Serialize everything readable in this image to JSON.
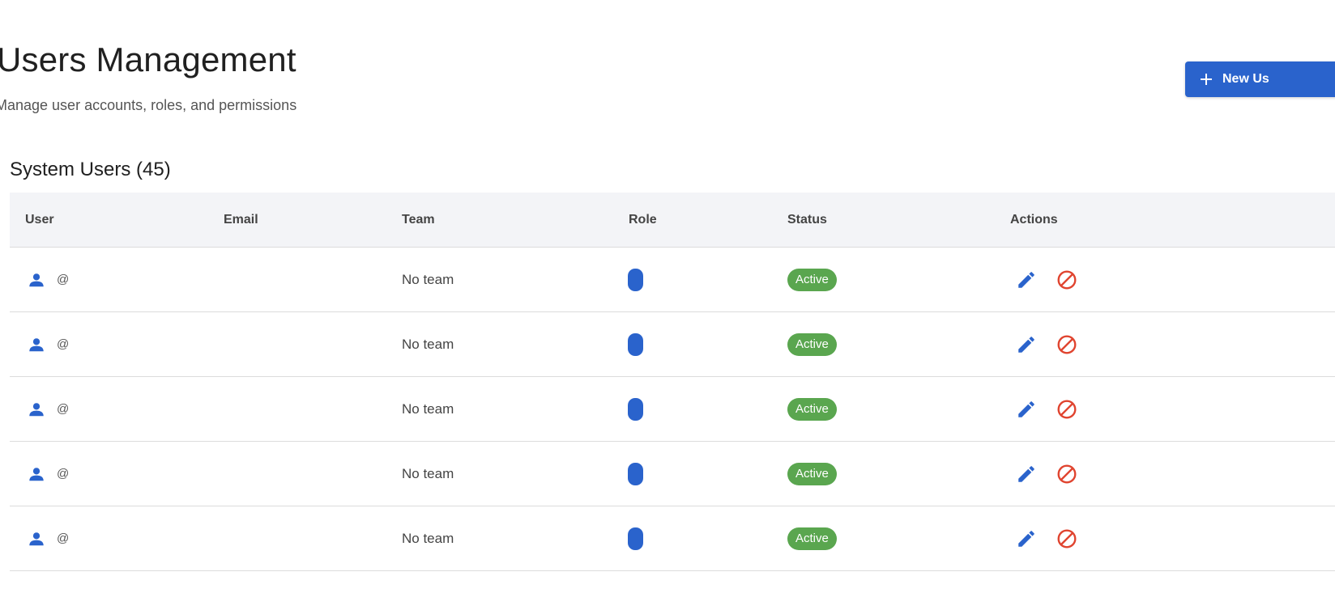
{
  "header": {
    "title": "Users Management",
    "subtitle": "Manage user accounts, roles, and permissions",
    "new_user_label": "New Us"
  },
  "section": {
    "title": "System Users (45)"
  },
  "table": {
    "columns": [
      "User",
      "Email",
      "Team",
      "Role",
      "Status",
      "Actions"
    ],
    "rows": [
      {
        "user_icon": "person-icon",
        "handle": "@",
        "email": "",
        "team": "No team",
        "role": "",
        "status": "Active"
      },
      {
        "user_icon": "person-icon",
        "handle": "@",
        "email": "",
        "team": "No team",
        "role": "",
        "status": "Active"
      },
      {
        "user_icon": "person-icon",
        "handle": "@",
        "email": "",
        "team": "No team",
        "role": "",
        "status": "Active"
      },
      {
        "user_icon": "person-icon",
        "handle": "@",
        "email": "",
        "team": "No team",
        "role": "",
        "status": "Active"
      },
      {
        "user_icon": "person-icon",
        "handle": "@",
        "email": "",
        "team": "No team",
        "role": "",
        "status": "Active"
      }
    ],
    "actions": [
      "edit-icon",
      "block-icon"
    ]
  },
  "colors": {
    "primary": "#2a63cc",
    "active": "#5aa64f",
    "danger": "#e0442f"
  }
}
